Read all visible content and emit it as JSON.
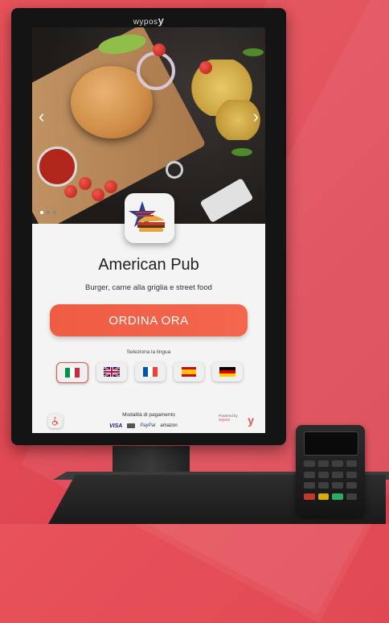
{
  "device": {
    "brand": "wypos",
    "brand_mark": "y"
  },
  "hero": {
    "prev_arrow": "‹",
    "next_arrow": "›",
    "slides": 3,
    "active_slide": 1
  },
  "restaurant": {
    "name": "American Pub",
    "description": "Burger, carne alla griglia e street food"
  },
  "order_button": {
    "label": "ORDINA ORA",
    "color": "#f0604a"
  },
  "language": {
    "label": "Seleziona la lingua",
    "options": [
      {
        "code": "it",
        "icon": "italy-flag-icon",
        "selected": true
      },
      {
        "code": "en",
        "icon": "uk-flag-icon",
        "selected": false
      },
      {
        "code": "fr",
        "icon": "france-flag-icon",
        "selected": false
      },
      {
        "code": "es",
        "icon": "spain-flag-icon",
        "selected": false
      },
      {
        "code": "de",
        "icon": "germany-flag-icon",
        "selected": false
      }
    ]
  },
  "footer": {
    "accessibility_icon": "wheelchair-icon",
    "payment_label": "Modalità di pagamento",
    "payment_methods": {
      "visa": "VISA",
      "paypal": "PayPal",
      "amazon": "amazon"
    },
    "powered_by": "Powered by",
    "powered_brand": "wypos",
    "powered_mark": "y"
  },
  "colors": {
    "background": "#e24a55",
    "accent": "#f0604a"
  }
}
